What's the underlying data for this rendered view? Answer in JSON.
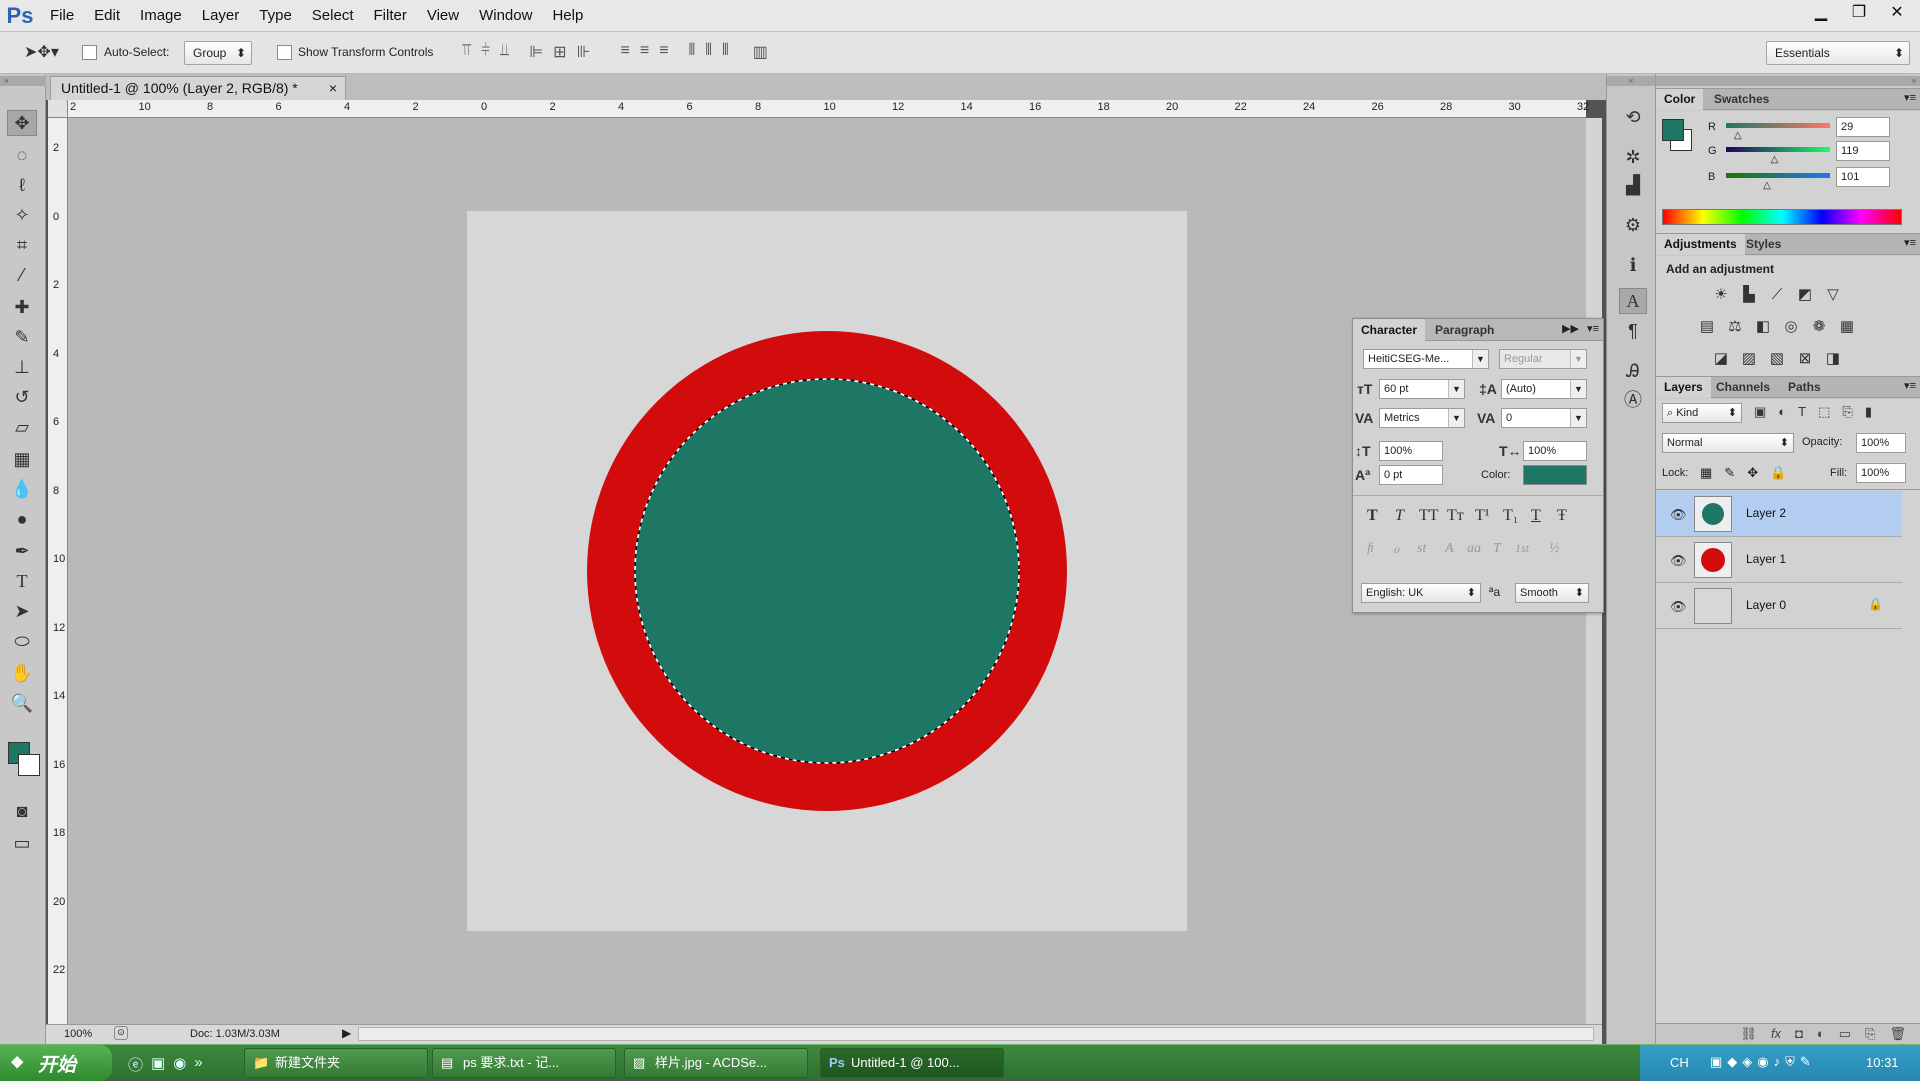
{
  "app": {
    "logo": "Ps"
  },
  "menu": [
    "File",
    "Edit",
    "Image",
    "Layer",
    "Type",
    "Select",
    "Filter",
    "View",
    "Window",
    "Help"
  ],
  "window_controls": {
    "minimize": "▁",
    "restore": "❐",
    "close": "✕"
  },
  "options": {
    "auto_select_label": "Auto-Select:",
    "auto_select_value": "Group",
    "transform_label": "Show Transform Controls",
    "workspace": "Essentials"
  },
  "document": {
    "tab_title": "Untitled-1 @ 100% (Layer 2, RGB/8) *",
    "close": "×",
    "zoom": "100%",
    "doc_info": "Doc: 1.03M/3.03M",
    "ruler_top": [
      "2",
      "10",
      "8",
      "6",
      "4",
      "2",
      "0",
      "2",
      "4",
      "6",
      "8",
      "10",
      "12",
      "14",
      "16",
      "18",
      "20",
      "22",
      "24",
      "26",
      "28",
      "30",
      "32"
    ],
    "ruler_left": [
      "2",
      "0",
      "2",
      "4",
      "6",
      "8",
      "10",
      "12",
      "14",
      "16",
      "18",
      "20",
      "22"
    ],
    "colors": {
      "canvas": "#d7d7d7",
      "ring": "#d20c0c",
      "fill": "#1e7765"
    }
  },
  "character": {
    "tabs": [
      "Character",
      "Paragraph"
    ],
    "font_family": "HeitiCSEG-Me...",
    "font_style": "Regular",
    "font_size": "60 pt",
    "leading": "(Auto)",
    "kerning": "Metrics",
    "tracking": "0",
    "vertical_scale": "100%",
    "horizontal_scale": "100%",
    "baseline_shift": "0 pt",
    "color_label": "Color:",
    "color": "#1e7765",
    "type_styles": [
      "T",
      "T",
      "TT",
      "Tт",
      "T¹",
      "T₁",
      "T",
      "Ŧ"
    ],
    "opentype": [
      "ﬁ",
      "ℴ",
      "st",
      "A",
      "aa",
      "T",
      "1st",
      "½"
    ],
    "language": "English: UK",
    "aa_icon": "ªa",
    "antialias": "Smooth"
  },
  "color_panel": {
    "tabs": [
      "Color",
      "Swatches"
    ],
    "r_label": "R",
    "g_label": "G",
    "b_label": "B",
    "r": "29",
    "g": "119",
    "b": "101",
    "r_level": 0.114,
    "g_level": 0.467,
    "b_level": 0.396,
    "foreground": "#1e7765"
  },
  "adjustments": {
    "tabs": [
      "Adjustments",
      "Styles"
    ],
    "heading": "Add an adjustment"
  },
  "layers": {
    "tabs": [
      "Layers",
      "Channels",
      "Paths"
    ],
    "filter": "Kind",
    "blend_mode": "Normal",
    "opacity_label": "Opacity:",
    "opacity": "100%",
    "lock_label": "Lock:",
    "fill_label": "Fill:",
    "fill": "100%",
    "items": [
      {
        "name": "Layer 2",
        "selected": true
      },
      {
        "name": "Layer 1",
        "selected": false
      },
      {
        "name": "Layer 0",
        "selected": false
      }
    ],
    "footer_icons": [
      "link-icon",
      "fx-icon",
      "mask-icon",
      "adjustment-icon",
      "folder-icon",
      "new-layer-icon",
      "trash-icon"
    ],
    "fx": "fx"
  },
  "taskbar": {
    "start": "开始",
    "items": [
      "新建文件夹",
      "ps 要求.txt - 记...",
      "样片.jpg - ACDSe...",
      "Untitled-1 @ 100..."
    ],
    "lang": "CH",
    "clock": "10:31"
  }
}
